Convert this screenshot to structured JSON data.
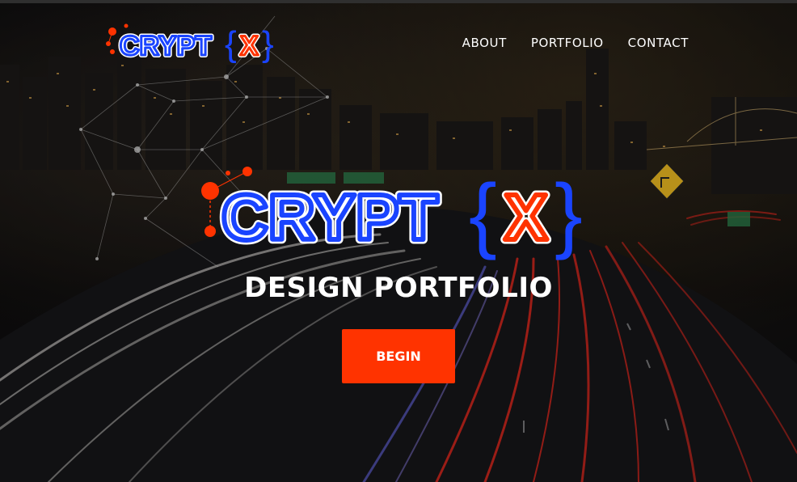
{
  "brand": {
    "name_main": "CRYPT",
    "name_open_brace": "{",
    "name_letter": "X",
    "name_close_brace": "}",
    "colors": {
      "blue": "#1a44ff",
      "red": "#ff3300",
      "white": "#ffffff"
    }
  },
  "nav": {
    "items": [
      {
        "label": "ABOUT"
      },
      {
        "label": "PORTFOLIO"
      },
      {
        "label": "CONTACT"
      }
    ]
  },
  "hero": {
    "tagline": "DESIGN PORTFOLIO",
    "cta_label": "BEGIN",
    "background": "night-highway-city-icon"
  }
}
